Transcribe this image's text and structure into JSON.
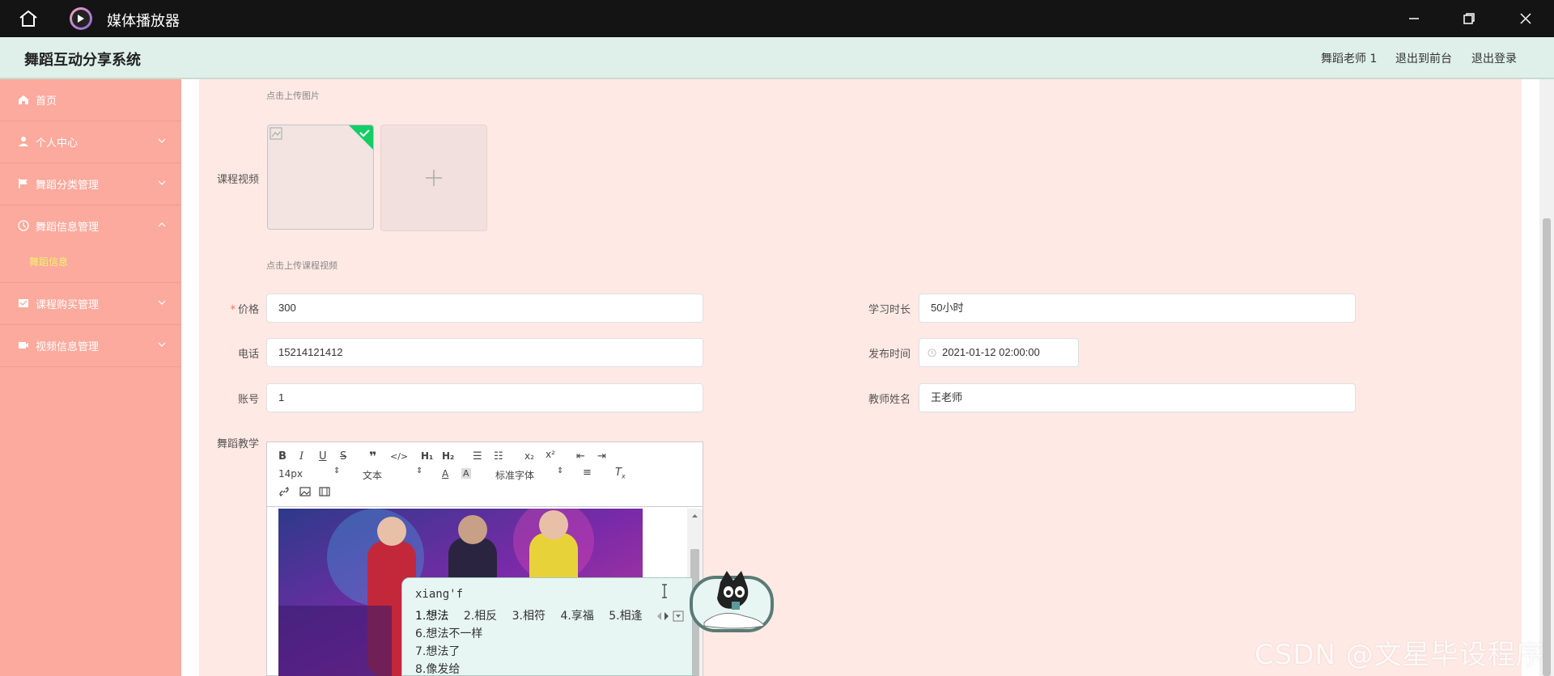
{
  "window": {
    "title": "媒体播放器"
  },
  "app": {
    "title": "舞蹈互动分享系统",
    "header_links": [
      "舞蹈老师 1",
      "退出到前台",
      "退出登录"
    ]
  },
  "sidebar": {
    "items": [
      {
        "label": "首页",
        "icon": "home-icon"
      },
      {
        "label": "个人中心",
        "icon": "user-icon"
      },
      {
        "label": "舞蹈分类管理",
        "icon": "flag-icon"
      },
      {
        "label": "舞蹈信息管理",
        "icon": "clock-icon"
      },
      {
        "label": "课程购买管理",
        "icon": "cart-icon"
      },
      {
        "label": "视频信息管理",
        "icon": "video-icon"
      }
    ],
    "sub_item": "舞蹈信息"
  },
  "form": {
    "upload_image_hint": "点击上传图片",
    "video_label": "课程视频",
    "upload_video_hint": "点击上传课程视频",
    "price": {
      "label": "价格",
      "value": "300"
    },
    "duration": {
      "label": "学习时长",
      "value": "50小时"
    },
    "phone": {
      "label": "电话",
      "value": "15214121412"
    },
    "publish_time": {
      "label": "发布时间",
      "value": "2021-01-12 02:00:00"
    },
    "account": {
      "label": "账号",
      "value": "1"
    },
    "teacher": {
      "label": "教师姓名",
      "value": "王老师"
    },
    "teaching_label": "舞蹈教学"
  },
  "editor": {
    "font_size": "14px",
    "block_type": "文本",
    "font_family": "标准字体"
  },
  "ime": {
    "code": "xiang'f",
    "candidates_row": [
      "1.想法",
      "2.相反",
      "3.相符",
      "4.享福",
      "5.相逢"
    ],
    "candidates_more": [
      "6.想法不一样",
      "7.想法了",
      "8.像发给"
    ]
  },
  "watermark": "CSDN @文星毕设程序"
}
